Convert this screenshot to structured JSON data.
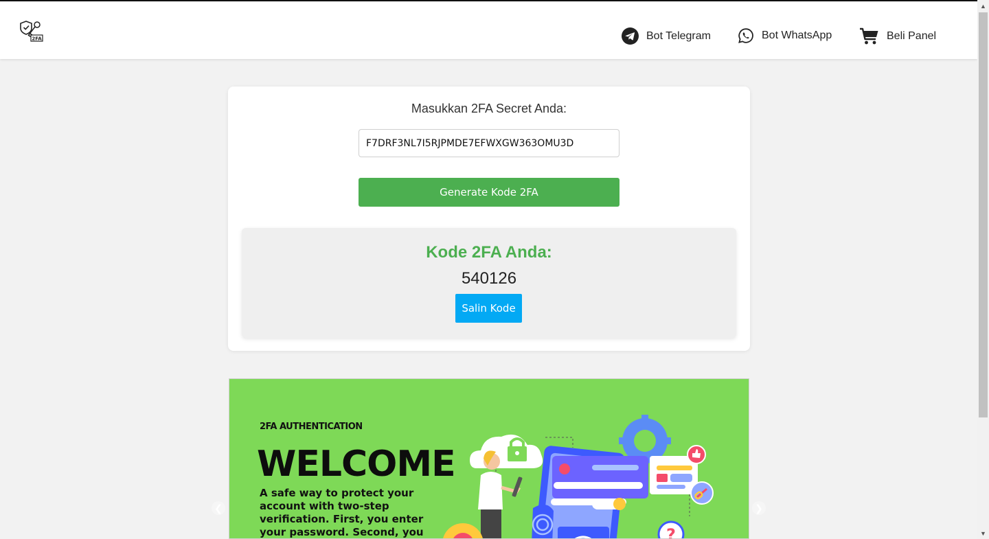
{
  "nav": {
    "logo_text": "2FA",
    "items": [
      {
        "label": "Bot Telegram",
        "icon": "telegram-icon"
      },
      {
        "label": "Bot WhatsApp",
        "icon": "whatsapp-icon"
      },
      {
        "label": "Beli Panel",
        "icon": "cart-icon"
      }
    ]
  },
  "form": {
    "label": "Masukkan 2FA Secret Anda:",
    "secret_value": "F7DRF3NL7I5RJPMDE7EFWXGW363OMU3D",
    "generate_label": "Generate Kode 2FA"
  },
  "result": {
    "title": "Kode 2FA Anda:",
    "code": "540126",
    "copy_label": "Salin Kode"
  },
  "banner": {
    "tag": "2FA AUTHENTICATION",
    "title": "WELCOME",
    "description": "A safe way to protect your account with two-step verification. First, you enter your password. Second, you enter a",
    "background": "#7ed957"
  },
  "colors": {
    "primary_green": "#4caf50",
    "copy_blue": "#03a9f4"
  }
}
